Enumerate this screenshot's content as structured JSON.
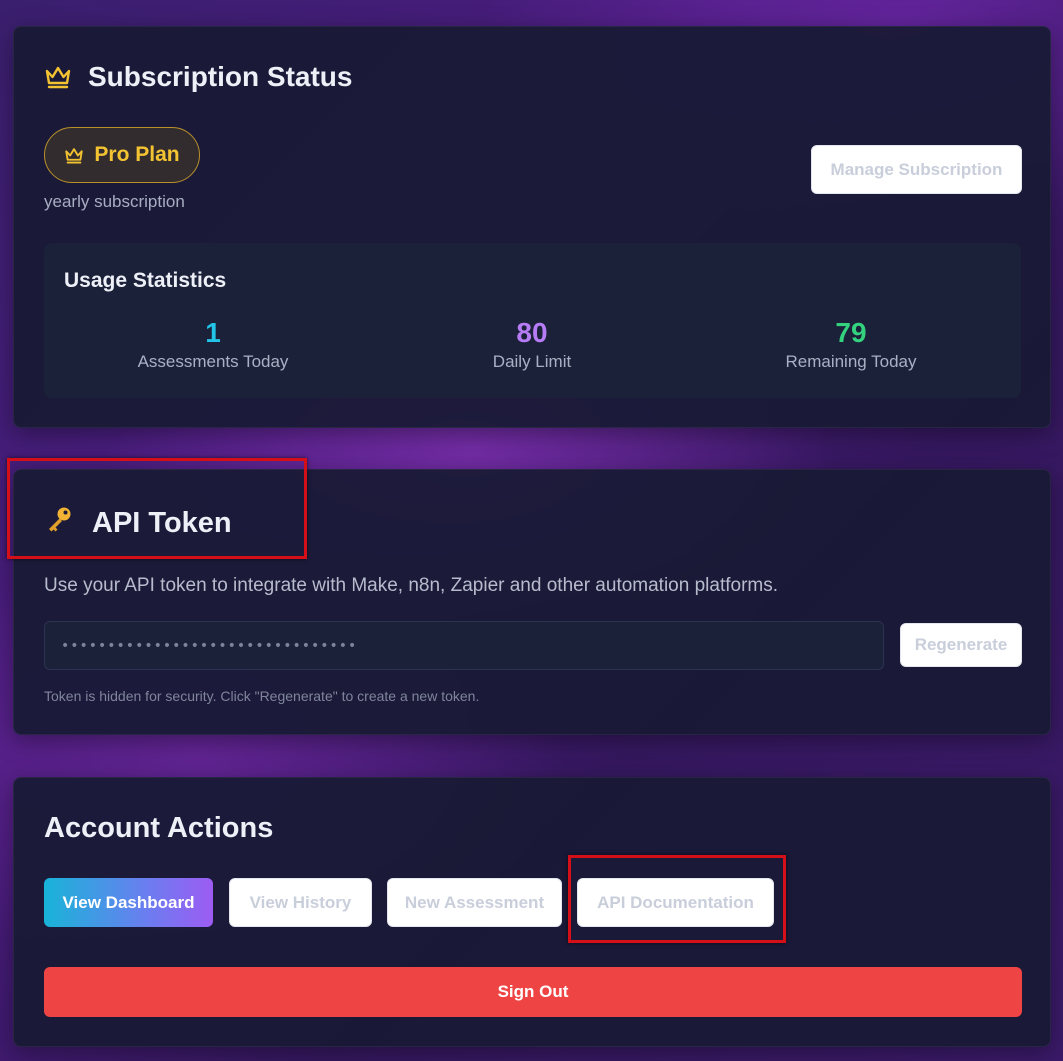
{
  "subscription": {
    "title": "Subscription Status",
    "title_icon": "crown-icon",
    "plan_label": "Pro Plan",
    "plan_icon": "crown-icon",
    "plan_period": "yearly subscription",
    "manage_label": "Manage Subscription",
    "usage": {
      "title": "Usage Statistics",
      "stats": [
        {
          "value": "1",
          "label": "Assessments Today",
          "color": "#22c4e8"
        },
        {
          "value": "80",
          "label": "Daily Limit",
          "color": "#b57cf6"
        },
        {
          "value": "79",
          "label": "Remaining Today",
          "color": "#34d17f"
        }
      ]
    }
  },
  "api_token": {
    "title": "API Token",
    "title_icon": "key-icon",
    "description": "Use your API token to integrate with Make, n8n, Zapier and other automation platforms.",
    "token_value": "••••••••••••••••••••••••••••••••",
    "regenerate_label": "Regenerate",
    "note": "Token is hidden for security. Click \"Regenerate\" to create a new token."
  },
  "account_actions": {
    "title": "Account Actions",
    "buttons": {
      "dashboard": "View Dashboard",
      "history": "View History",
      "new_assessment": "New Assessment",
      "api_docs": "API Documentation"
    },
    "sign_out": "Sign Out"
  },
  "colors": {
    "accent_gold": "#f3c332",
    "sign_out_red": "#ee4444",
    "highlight_red": "#d40f18"
  }
}
